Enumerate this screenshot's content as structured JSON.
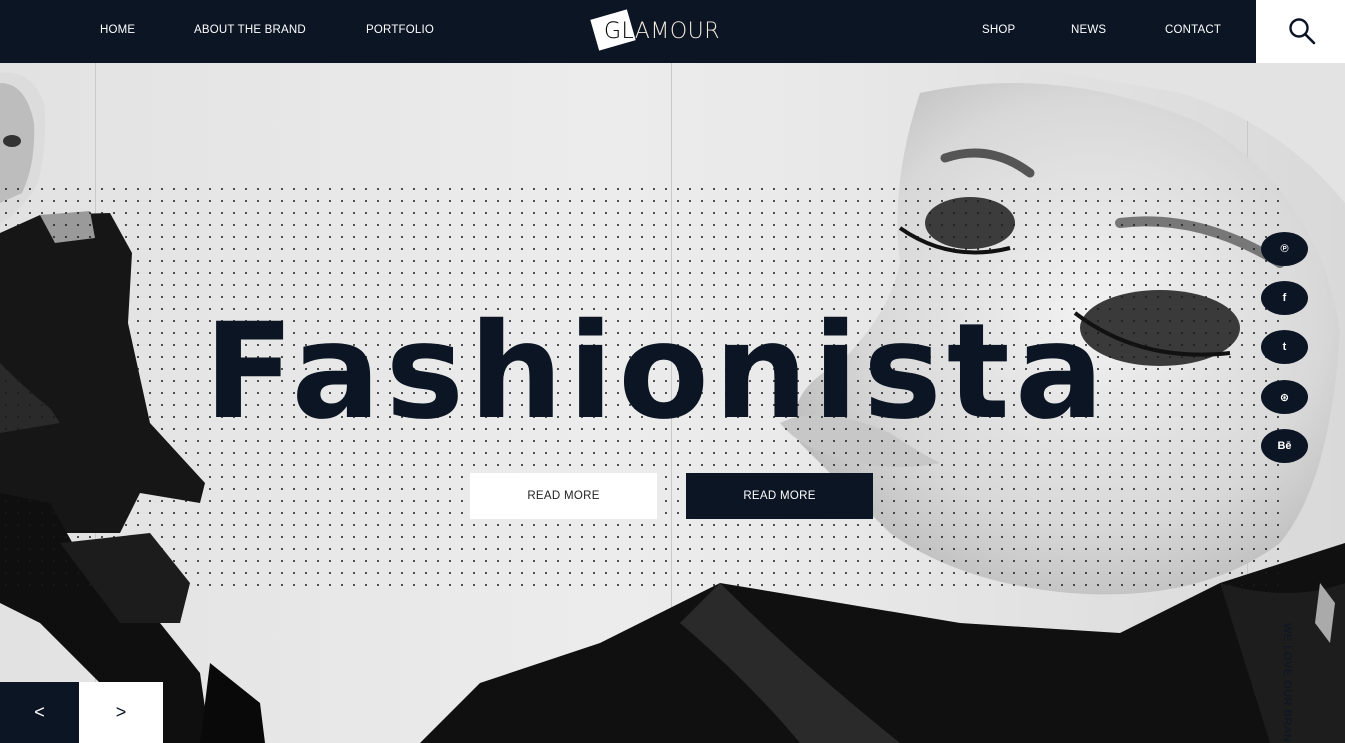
{
  "nav": {
    "left": [
      {
        "label": "HOME"
      },
      {
        "label": "ABOUT THE BRAND"
      },
      {
        "label": "PORTFOLIO"
      }
    ],
    "right": [
      {
        "label": "SHOP"
      },
      {
        "label": "NEWS"
      },
      {
        "label": "CONTACT"
      }
    ],
    "logo_text": "GLAMOUR",
    "search_icon": "search-icon"
  },
  "hero": {
    "headline": "Fashionista",
    "buttons": [
      {
        "label": "READ MORE"
      },
      {
        "label": "READ MORE"
      }
    ],
    "tagline": "WE LOVE OUR BRAND",
    "prev_glyph": "<",
    "next_glyph": ">"
  },
  "social": [
    {
      "icon": "pinterest-icon",
      "glyph": "℗"
    },
    {
      "icon": "facebook-icon",
      "glyph": "f"
    },
    {
      "icon": "twitter-icon",
      "glyph": "t"
    },
    {
      "icon": "dribbble-icon",
      "glyph": "⊛"
    },
    {
      "icon": "behance-icon",
      "glyph": "Bē"
    }
  ],
  "colors": {
    "navy": "#0c1524",
    "white": "#ffffff",
    "background": "#e9e9e9"
  }
}
